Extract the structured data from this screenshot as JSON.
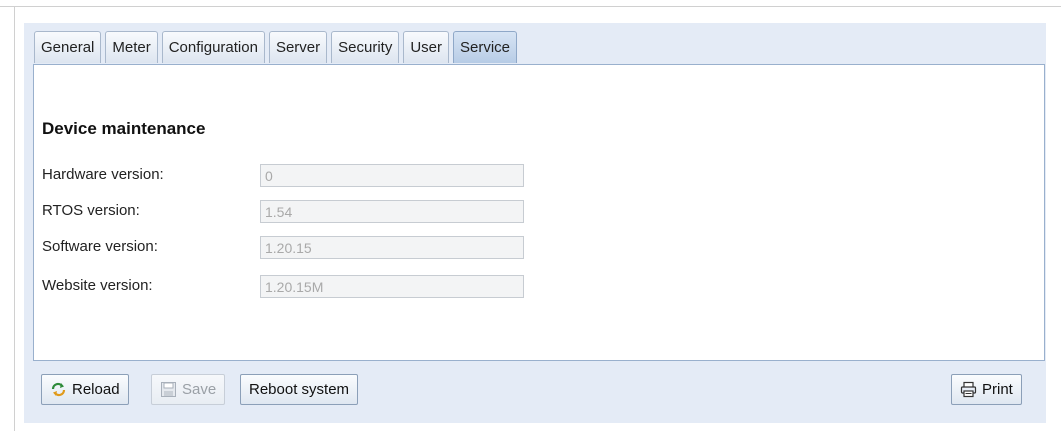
{
  "tabs": [
    {
      "label": "General"
    },
    {
      "label": "Meter"
    },
    {
      "label": "Configuration"
    },
    {
      "label": "Server"
    },
    {
      "label": "Security"
    },
    {
      "label": "User"
    },
    {
      "label": "Service",
      "active": true
    }
  ],
  "section": {
    "title": "Device maintenance",
    "fields": [
      {
        "label": "Hardware version:",
        "value": "0"
      },
      {
        "label": "RTOS version:",
        "value": "1.54"
      },
      {
        "label": "Software version:",
        "value": "1.20.15"
      },
      {
        "label": "Website version:",
        "value": "1.20.15M"
      }
    ]
  },
  "toolbar": {
    "reload_label": "Reload",
    "save_label": "Save",
    "reboot_label": "Reboot system",
    "print_label": "Print"
  },
  "icons": {
    "reload": "reload-icon",
    "save": "save-icon",
    "print": "print-icon"
  },
  "colors": {
    "panel_bg": "#e4ebf6",
    "active_tab": "#b7cce6",
    "border": "#99b0cd"
  }
}
